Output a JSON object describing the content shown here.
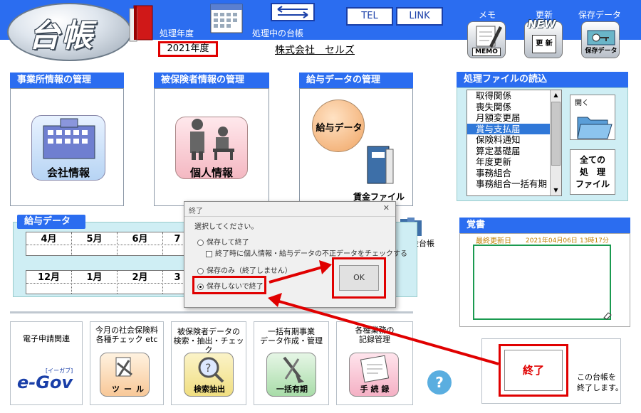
{
  "header": {
    "logo_text": "台帳",
    "year_label": "処理年度",
    "current_ledger_label": "処理中の台帳",
    "year_value": "2021年度",
    "company_name": "株式会社　セルズ",
    "tel_label": "TEL",
    "link_label": "LINK",
    "memo_label": "メモ",
    "update_label": "更新",
    "save_data_label": "保存データ",
    "memo_icon_text": "MEMO",
    "new_icon_text": "NEW",
    "update_icon_text": "更 新",
    "save_icon_text": "保存データ"
  },
  "panels": {
    "office": {
      "title": "事業所情報の管理",
      "button": "会社情報"
    },
    "insured": {
      "title": "被保険者情報の管理",
      "button": "個人情報"
    },
    "salary": {
      "title": "給与データの管理",
      "button": "給与データ",
      "wage_file": "賃金ファイル",
      "wage_ledger": "賃金台帳"
    }
  },
  "file_panel": {
    "title": "処理ファイルの読込",
    "items": [
      "取得関係",
      "喪失関係",
      "月額変更届",
      "賞与支払届",
      "保険料通知",
      "算定基礎届",
      "年度更新",
      "事務組合",
      "事務組合一括有期"
    ],
    "selected_index": 3,
    "open_label": "開く",
    "all_files_line1": "全ての",
    "all_files_line2": "処　理",
    "all_files_line3": "ファイル"
  },
  "salary_data": {
    "title": "給与データ",
    "months_row1": [
      "4月",
      "5月",
      "6月",
      "7"
    ],
    "months_row2": [
      "12月",
      "1月",
      "2月",
      "3"
    ]
  },
  "memo_panel": {
    "title": "覚書",
    "last_updated_label": "最終更新日",
    "last_updated_date": "2021年04月06日",
    "last_updated_time": "13時17分"
  },
  "bottom": {
    "egov_label": "電子申請関連",
    "egov_logo": "e-Gov",
    "egov_small": "[イーガブ]",
    "check_label_line1": "今月の社会保険料",
    "check_label_line2": "各種チェック etc",
    "tool_label": "ツール",
    "search_label_line1": "被保険者データの",
    "search_label_line2": "検索・抽出・チェック",
    "search_button": "検索抽出",
    "bulk_label_line1": "一括有期事業",
    "bulk_label_line2": "データ作成・管理",
    "bulk_button": "一括有期",
    "record_label_line1": "各種業務の",
    "record_label_line2": "記録管理",
    "record_button": "手 続 録",
    "help_icon": "?",
    "exit_button": "終了",
    "exit_desc_line1": "この台帳を",
    "exit_desc_line2": "終了します。"
  },
  "dialog": {
    "title": "終了",
    "close_glyph": "✕",
    "prompt": "選択してください。",
    "option_save_exit": "保存して終了",
    "option_check": "終了時に個人情報・給与データの不正データをチェックする",
    "option_save_only": "保存のみ（終了しません）",
    "option_no_save_exit": "保存しないで終了",
    "ok_label": "OK"
  },
  "colors": {
    "header_blue": "#2b6df0",
    "highlight_red": "#e00000",
    "selection_blue": "#3078d8"
  }
}
